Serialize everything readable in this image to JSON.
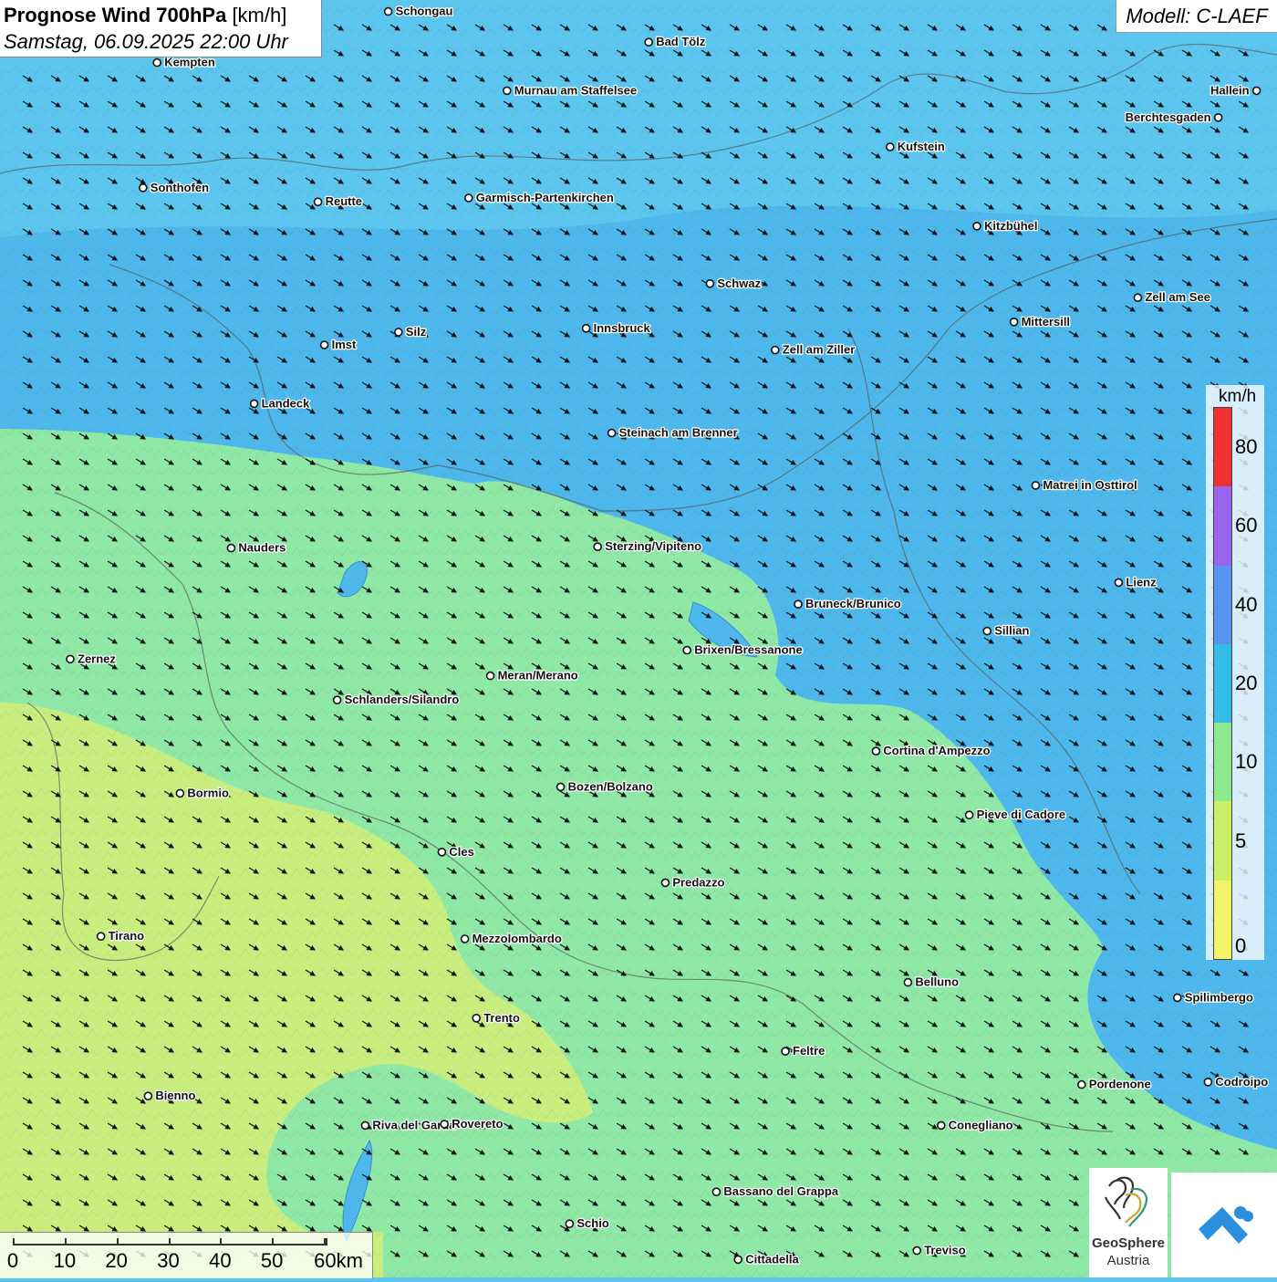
{
  "header": {
    "title_main": "Prognose Wind 700hPa",
    "title_unit": "[km/h]",
    "datetime": "Samstag, 06.09.2025 22:00 Uhr"
  },
  "model": "Modell: C-LAEF",
  "legend": {
    "unit": "km/h",
    "ticks": [
      "80",
      "60",
      "40",
      "20",
      "10",
      "5",
      "0"
    ],
    "colors": [
      "#f03030",
      "#9a66ee",
      "#5a94f0",
      "#34bde8",
      "#8fe88f",
      "#c7f064",
      "#f4f468"
    ]
  },
  "scale_bar": {
    "labels": [
      "0",
      "10",
      "20",
      "30",
      "40",
      "50",
      "60km"
    ]
  },
  "branding": {
    "geosphere_line1": "GeoSphere",
    "geosphere_line2": "Austria"
  },
  "field_colors": {
    "strong": "#4eb8ec",
    "medium": "#5cc6ef",
    "weak": "#8fe8a6",
    "calm": "#c8ee80"
  },
  "wind_direction": "from west-northwest",
  "cities": [
    {
      "name": "Schongau",
      "dx": 0.304,
      "dy": 0.009
    },
    {
      "name": "Bad Tölz",
      "dx": 0.508,
      "dy": 0.033
    },
    {
      "name": "Kempten",
      "dx": 0.123,
      "dy": 0.049
    },
    {
      "name": "Murnau am Staffelsee",
      "dx": 0.397,
      "dy": 0.071
    },
    {
      "name": "Hallein",
      "dx": 0.984,
      "dy": 0.071
    },
    {
      "name": "Berchtesgaden",
      "dx": 0.954,
      "dy": 0.092
    },
    {
      "name": "Kufstein",
      "dx": 0.697,
      "dy": 0.115
    },
    {
      "name": "Sonthofen",
      "dx": 0.112,
      "dy": 0.147
    },
    {
      "name": "Reutte",
      "dx": 0.249,
      "dy": 0.158
    },
    {
      "name": "Garmisch-Partenkirchen",
      "dx": 0.367,
      "dy": 0.155
    },
    {
      "name": "Kitzbühel",
      "dx": 0.765,
      "dy": 0.177
    },
    {
      "name": "Schwaz",
      "dx": 0.556,
      "dy": 0.222
    },
    {
      "name": "Zell am See",
      "dx": 0.891,
      "dy": 0.233
    },
    {
      "name": "Mittersill",
      "dx": 0.794,
      "dy": 0.252
    },
    {
      "name": "Innsbruck",
      "dx": 0.459,
      "dy": 0.257
    },
    {
      "name": "Silz",
      "dx": 0.312,
      "dy": 0.26
    },
    {
      "name": "Imst",
      "dx": 0.254,
      "dy": 0.27
    },
    {
      "name": "Zell am Ziller",
      "dx": 0.607,
      "dy": 0.274
    },
    {
      "name": "Landeck",
      "dx": 0.199,
      "dy": 0.316
    },
    {
      "name": "Steinach am Brenner",
      "dx": 0.479,
      "dy": 0.339
    },
    {
      "name": "Matrei in Osttirol",
      "dx": 0.811,
      "dy": 0.38
    },
    {
      "name": "Nauders",
      "dx": 0.181,
      "dy": 0.429
    },
    {
      "name": "Sterzing/Vipiteno",
      "dx": 0.468,
      "dy": 0.428
    },
    {
      "name": "Lienz",
      "dx": 0.876,
      "dy": 0.456
    },
    {
      "name": "Bruneck/Brunico",
      "dx": 0.625,
      "dy": 0.473
    },
    {
      "name": "Sillian",
      "dx": 0.773,
      "dy": 0.494
    },
    {
      "name": "Zernez",
      "dx": 0.055,
      "dy": 0.516
    },
    {
      "name": "Brixen/Bressanone",
      "dx": 0.538,
      "dy": 0.509
    },
    {
      "name": "Meran/Merano",
      "dx": 0.384,
      "dy": 0.529
    },
    {
      "name": "Schlanders/Silandro",
      "dx": 0.264,
      "dy": 0.548
    },
    {
      "name": "Cortina d'Ampezzo",
      "dx": 0.686,
      "dy": 0.588
    },
    {
      "name": "Bozen/Bolzano",
      "dx": 0.439,
      "dy": 0.616
    },
    {
      "name": "Bormio",
      "dx": 0.141,
      "dy": 0.621
    },
    {
      "name": "Pieve di Cadore",
      "dx": 0.759,
      "dy": 0.638
    },
    {
      "name": "Cles",
      "dx": 0.346,
      "dy": 0.667
    },
    {
      "name": "Predazzo",
      "dx": 0.521,
      "dy": 0.691
    },
    {
      "name": "Tirano",
      "dx": 0.079,
      "dy": 0.733
    },
    {
      "name": "Mezzolombardo",
      "dx": 0.364,
      "dy": 0.735
    },
    {
      "name": "Belluno",
      "dx": 0.711,
      "dy": 0.769
    },
    {
      "name": "Spilimbergo",
      "dx": 0.922,
      "dy": 0.781
    },
    {
      "name": "Trento",
      "dx": 0.373,
      "dy": 0.797
    },
    {
      "name": "Feltre",
      "dx": 0.615,
      "dy": 0.823
    },
    {
      "name": "Pordenone",
      "dx": 0.847,
      "dy": 0.849
    },
    {
      "name": "Codroipo",
      "dx": 0.946,
      "dy": 0.847
    },
    {
      "name": "Bienno",
      "dx": 0.116,
      "dy": 0.858
    },
    {
      "name": "Riva del Garda",
      "dx": 0.286,
      "dy": 0.881
    },
    {
      "name": "Rovereto",
      "dx": 0.348,
      "dy": 0.88
    },
    {
      "name": "Conegliano",
      "dx": 0.737,
      "dy": 0.881
    },
    {
      "name": "Bassano del Grappa",
      "dx": 0.561,
      "dy": 0.933
    },
    {
      "name": "Schio",
      "dx": 0.446,
      "dy": 0.958
    },
    {
      "name": "Treviso",
      "dx": 0.718,
      "dy": 0.979
    },
    {
      "name": "Cittadella",
      "dx": 0.578,
      "dy": 0.986
    }
  ]
}
